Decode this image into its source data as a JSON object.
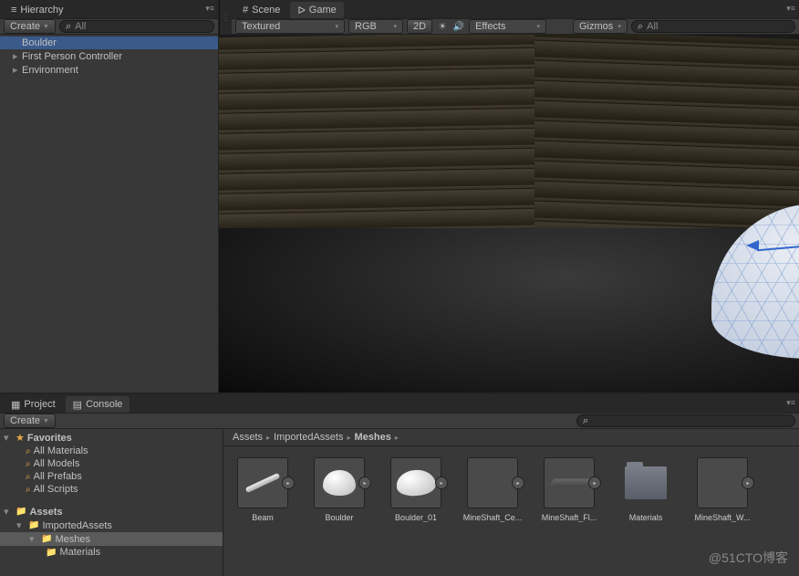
{
  "hierarchy": {
    "tab": "Hierarchy",
    "create": "Create",
    "search_placeholder": "All",
    "items": [
      "Boulder",
      "First Person Controller",
      "Environment"
    ]
  },
  "scene": {
    "tab_scene": "Scene",
    "tab_game": "Game",
    "shading": "Textured",
    "render_mode": "RGB",
    "mode_2d": "2D",
    "effects": "Effects",
    "gizmos": "Gizmos",
    "search_placeholder": "All"
  },
  "project": {
    "tab_project": "Project",
    "tab_console": "Console",
    "create": "Create",
    "favorites": "Favorites",
    "fav_items": [
      "All Materials",
      "All Models",
      "All Prefabs",
      "All Scripts"
    ],
    "assets_root": "Assets",
    "folders": {
      "imported": "ImportedAssets",
      "meshes": "Meshes",
      "materials": "Materials"
    },
    "breadcrumb": [
      "Assets",
      "ImportedAssets",
      "Meshes"
    ],
    "grid": [
      {
        "label": "Beam",
        "kind": "beam"
      },
      {
        "label": "Boulder",
        "kind": "blob"
      },
      {
        "label": "Boulder_01",
        "kind": "blob2"
      },
      {
        "label": "MineShaft_Ce...",
        "kind": "empty"
      },
      {
        "label": "MineShaft_Fl...",
        "kind": "plane"
      },
      {
        "label": "Materials",
        "kind": "folder"
      },
      {
        "label": "MineShaft_W...",
        "kind": "empty"
      }
    ]
  },
  "watermark": "@51CTO博客"
}
